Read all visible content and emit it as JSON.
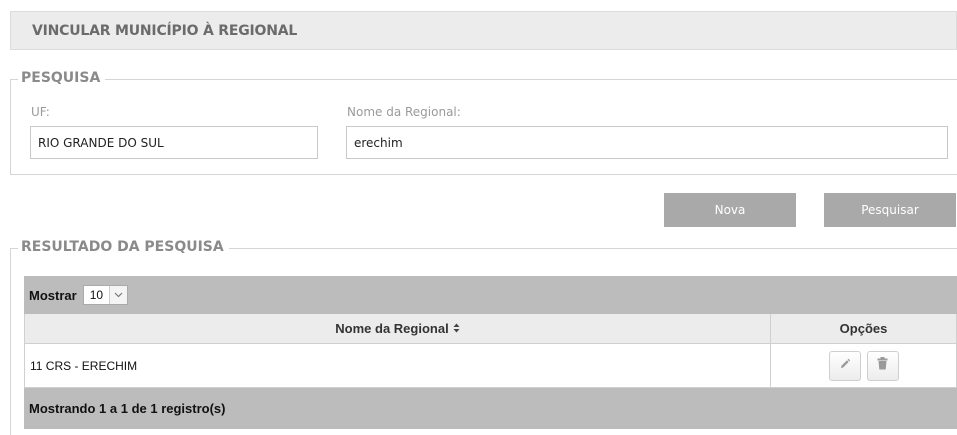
{
  "header": {
    "title": "VINCULAR MUNICÍPIO À REGIONAL"
  },
  "search": {
    "legend": "PESQUISA",
    "uf_label": "UF:",
    "uf_value": "RIO GRANDE DO SUL",
    "regional_label": "Nome da Regional:",
    "regional_value": "erechim"
  },
  "actions": {
    "new_label": "Nova",
    "search_label": "Pesquisar"
  },
  "results": {
    "legend": "RESULTADO DA PESQUISA",
    "show_label": "Mostrar",
    "page_size": "10",
    "columns": {
      "name": "Nome da Regional",
      "options": "Opções"
    },
    "rows": [
      {
        "name": "11 CRS - ERECHIM"
      }
    ],
    "footer": "Mostrando 1 a 1 de 1 registro(s)"
  },
  "icons": {
    "edit": "pencil-icon",
    "delete": "trash-icon",
    "sort": "sort-icon",
    "dropdown": "chevron-down-icon"
  }
}
